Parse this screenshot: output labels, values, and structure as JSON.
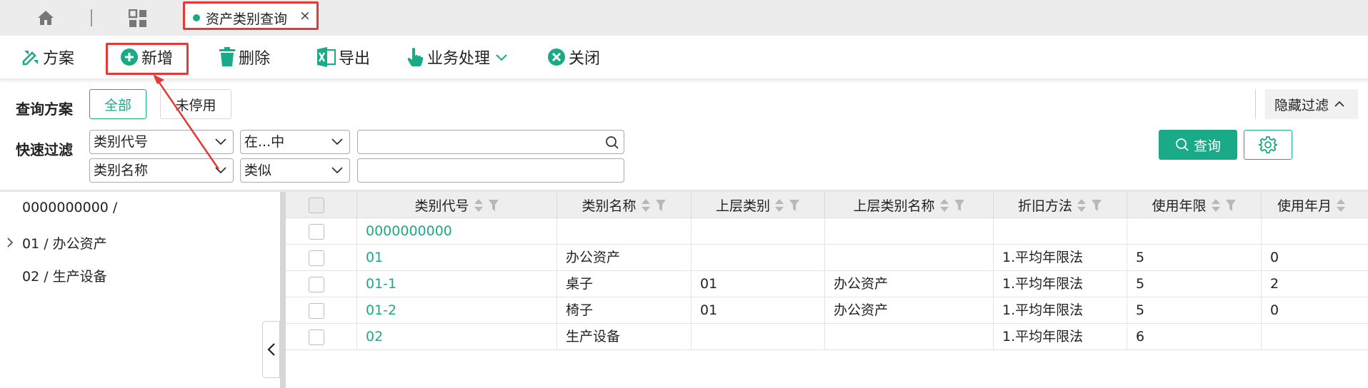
{
  "tabbar": {
    "tab_title": "资产类别查询",
    "tab_close": "×"
  },
  "toolbar": {
    "scheme_label": "方案",
    "new_label": "新增",
    "delete_label": "删除",
    "export_label": "导出",
    "business_label": "业务处理",
    "close_label": "关闭"
  },
  "filter": {
    "scheme_title": "查询方案",
    "scheme_all": "全部",
    "scheme_active": "未停用",
    "quick_title": "快速过滤",
    "field1": "类别代号",
    "op1": "在...中",
    "field2": "类别名称",
    "op2": "类似",
    "hide_filter": "隐藏过滤",
    "query_label": "查询"
  },
  "tree": {
    "items": [
      "0000000000 /",
      "01 / 办公资产",
      "02 / 生产设备"
    ]
  },
  "grid": {
    "columns": [
      "类别代号",
      "类别名称",
      "上层类别",
      "上层类别名称",
      "折旧方法",
      "使用年限",
      "使用年月"
    ],
    "rows": [
      {
        "code": "0000000000",
        "name": "",
        "parent": "",
        "parent_name": "",
        "method": "",
        "years": "",
        "months": ""
      },
      {
        "code": "01",
        "name": "办公资产",
        "parent": "",
        "parent_name": "",
        "method": "1.平均年限法",
        "years": "5",
        "months": "0"
      },
      {
        "code": "01-1",
        "name": "桌子",
        "parent": "01",
        "parent_name": "办公资产",
        "method": "1.平均年限法",
        "years": "5",
        "months": "2"
      },
      {
        "code": "01-2",
        "name": "椅子",
        "parent": "01",
        "parent_name": "办公资产",
        "method": "1.平均年限法",
        "years": "5",
        "months": "0"
      },
      {
        "code": "02",
        "name": "生产设备",
        "parent": "",
        "parent_name": "",
        "method": "1.平均年限法",
        "years": "6",
        "months": ""
      }
    ]
  },
  "colors": {
    "accent": "#1aaa88",
    "highlight": "#e53935"
  }
}
